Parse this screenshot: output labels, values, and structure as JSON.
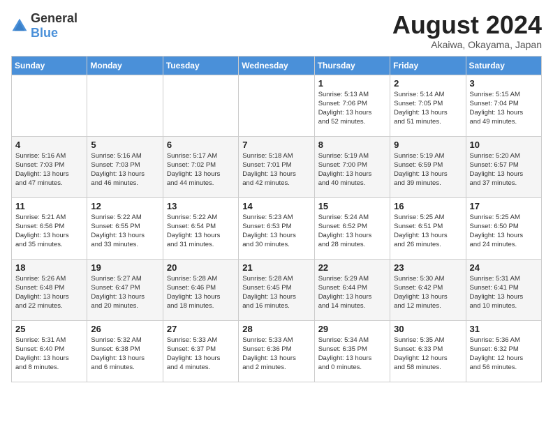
{
  "header": {
    "logo_general": "General",
    "logo_blue": "Blue",
    "month_year": "August 2024",
    "location": "Akaiwa, Okayama, Japan"
  },
  "weekdays": [
    "Sunday",
    "Monday",
    "Tuesday",
    "Wednesday",
    "Thursday",
    "Friday",
    "Saturday"
  ],
  "weeks": [
    [
      {
        "day": "",
        "info": ""
      },
      {
        "day": "",
        "info": ""
      },
      {
        "day": "",
        "info": ""
      },
      {
        "day": "",
        "info": ""
      },
      {
        "day": "1",
        "info": "Sunrise: 5:13 AM\nSunset: 7:06 PM\nDaylight: 13 hours\nand 52 minutes."
      },
      {
        "day": "2",
        "info": "Sunrise: 5:14 AM\nSunset: 7:05 PM\nDaylight: 13 hours\nand 51 minutes."
      },
      {
        "day": "3",
        "info": "Sunrise: 5:15 AM\nSunset: 7:04 PM\nDaylight: 13 hours\nand 49 minutes."
      }
    ],
    [
      {
        "day": "4",
        "info": "Sunrise: 5:16 AM\nSunset: 7:03 PM\nDaylight: 13 hours\nand 47 minutes."
      },
      {
        "day": "5",
        "info": "Sunrise: 5:16 AM\nSunset: 7:03 PM\nDaylight: 13 hours\nand 46 minutes."
      },
      {
        "day": "6",
        "info": "Sunrise: 5:17 AM\nSunset: 7:02 PM\nDaylight: 13 hours\nand 44 minutes."
      },
      {
        "day": "7",
        "info": "Sunrise: 5:18 AM\nSunset: 7:01 PM\nDaylight: 13 hours\nand 42 minutes."
      },
      {
        "day": "8",
        "info": "Sunrise: 5:19 AM\nSunset: 7:00 PM\nDaylight: 13 hours\nand 40 minutes."
      },
      {
        "day": "9",
        "info": "Sunrise: 5:19 AM\nSunset: 6:59 PM\nDaylight: 13 hours\nand 39 minutes."
      },
      {
        "day": "10",
        "info": "Sunrise: 5:20 AM\nSunset: 6:57 PM\nDaylight: 13 hours\nand 37 minutes."
      }
    ],
    [
      {
        "day": "11",
        "info": "Sunrise: 5:21 AM\nSunset: 6:56 PM\nDaylight: 13 hours\nand 35 minutes."
      },
      {
        "day": "12",
        "info": "Sunrise: 5:22 AM\nSunset: 6:55 PM\nDaylight: 13 hours\nand 33 minutes."
      },
      {
        "day": "13",
        "info": "Sunrise: 5:22 AM\nSunset: 6:54 PM\nDaylight: 13 hours\nand 31 minutes."
      },
      {
        "day": "14",
        "info": "Sunrise: 5:23 AM\nSunset: 6:53 PM\nDaylight: 13 hours\nand 30 minutes."
      },
      {
        "day": "15",
        "info": "Sunrise: 5:24 AM\nSunset: 6:52 PM\nDaylight: 13 hours\nand 28 minutes."
      },
      {
        "day": "16",
        "info": "Sunrise: 5:25 AM\nSunset: 6:51 PM\nDaylight: 13 hours\nand 26 minutes."
      },
      {
        "day": "17",
        "info": "Sunrise: 5:25 AM\nSunset: 6:50 PM\nDaylight: 13 hours\nand 24 minutes."
      }
    ],
    [
      {
        "day": "18",
        "info": "Sunrise: 5:26 AM\nSunset: 6:48 PM\nDaylight: 13 hours\nand 22 minutes."
      },
      {
        "day": "19",
        "info": "Sunrise: 5:27 AM\nSunset: 6:47 PM\nDaylight: 13 hours\nand 20 minutes."
      },
      {
        "day": "20",
        "info": "Sunrise: 5:28 AM\nSunset: 6:46 PM\nDaylight: 13 hours\nand 18 minutes."
      },
      {
        "day": "21",
        "info": "Sunrise: 5:28 AM\nSunset: 6:45 PM\nDaylight: 13 hours\nand 16 minutes."
      },
      {
        "day": "22",
        "info": "Sunrise: 5:29 AM\nSunset: 6:44 PM\nDaylight: 13 hours\nand 14 minutes."
      },
      {
        "day": "23",
        "info": "Sunrise: 5:30 AM\nSunset: 6:42 PM\nDaylight: 13 hours\nand 12 minutes."
      },
      {
        "day": "24",
        "info": "Sunrise: 5:31 AM\nSunset: 6:41 PM\nDaylight: 13 hours\nand 10 minutes."
      }
    ],
    [
      {
        "day": "25",
        "info": "Sunrise: 5:31 AM\nSunset: 6:40 PM\nDaylight: 13 hours\nand 8 minutes."
      },
      {
        "day": "26",
        "info": "Sunrise: 5:32 AM\nSunset: 6:38 PM\nDaylight: 13 hours\nand 6 minutes."
      },
      {
        "day": "27",
        "info": "Sunrise: 5:33 AM\nSunset: 6:37 PM\nDaylight: 13 hours\nand 4 minutes."
      },
      {
        "day": "28",
        "info": "Sunrise: 5:33 AM\nSunset: 6:36 PM\nDaylight: 13 hours\nand 2 minutes."
      },
      {
        "day": "29",
        "info": "Sunrise: 5:34 AM\nSunset: 6:35 PM\nDaylight: 13 hours\nand 0 minutes."
      },
      {
        "day": "30",
        "info": "Sunrise: 5:35 AM\nSunset: 6:33 PM\nDaylight: 12 hours\nand 58 minutes."
      },
      {
        "day": "31",
        "info": "Sunrise: 5:36 AM\nSunset: 6:32 PM\nDaylight: 12 hours\nand 56 minutes."
      }
    ]
  ]
}
